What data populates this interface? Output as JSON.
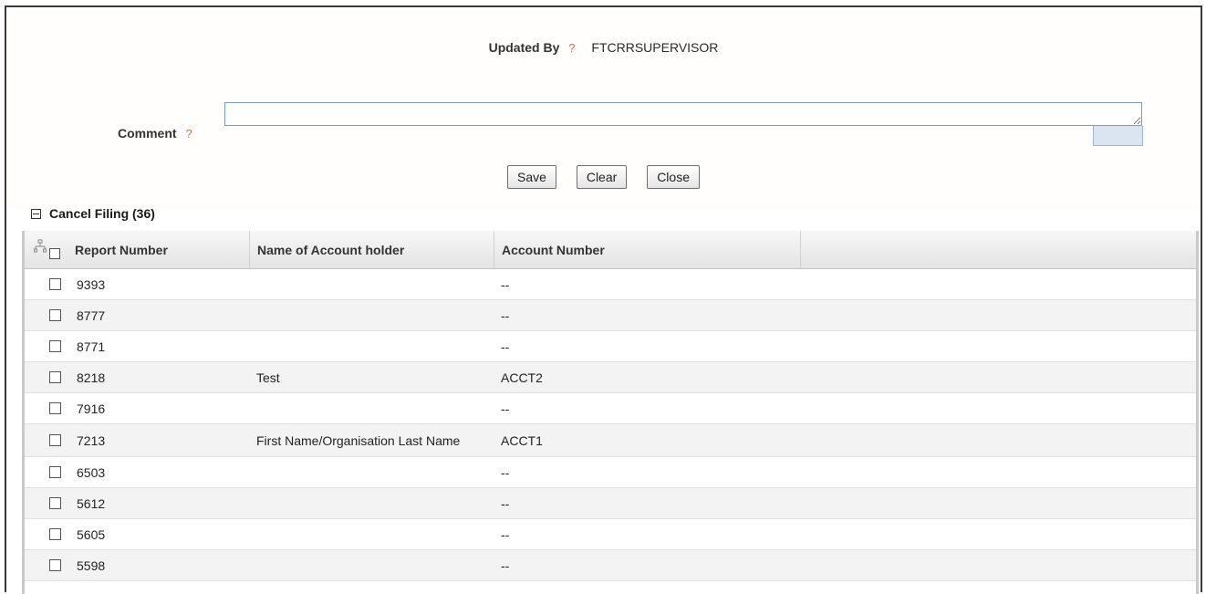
{
  "form": {
    "updated_by_label": "Updated By",
    "updated_by_value": "FTCRRSUPERVISOR",
    "help_glyph": "?",
    "comment_label": "Comment",
    "comment_value": ""
  },
  "buttons": {
    "save": "Save",
    "clear": "Clear",
    "close": "Close"
  },
  "section": {
    "title": "Cancel Filing (36)"
  },
  "grid": {
    "columns": [
      "Report Number",
      "Name of Account holder",
      "Account Number"
    ],
    "rows": [
      {
        "report_number": "9393",
        "account_holder": "",
        "account_number": "--"
      },
      {
        "report_number": "8777",
        "account_holder": "",
        "account_number": "--"
      },
      {
        "report_number": "8771",
        "account_holder": "",
        "account_number": "--"
      },
      {
        "report_number": "8218",
        "account_holder": "Test",
        "account_number": "ACCT2"
      },
      {
        "report_number": "7916",
        "account_holder": "",
        "account_number": "--"
      },
      {
        "report_number": "7213",
        "account_holder": "First Name/Organisation Last Name",
        "account_number": "ACCT1"
      },
      {
        "report_number": "6503",
        "account_holder": "",
        "account_number": "--"
      },
      {
        "report_number": "5612",
        "account_holder": "",
        "account_number": "--"
      },
      {
        "report_number": "5605",
        "account_holder": "",
        "account_number": "--"
      },
      {
        "report_number": "5598",
        "account_holder": "",
        "account_number": "--"
      }
    ]
  },
  "colors": {
    "help_icon": "#d46a5a",
    "input_border": "#7a9cc4",
    "row_alt": "#f3f3f3"
  }
}
